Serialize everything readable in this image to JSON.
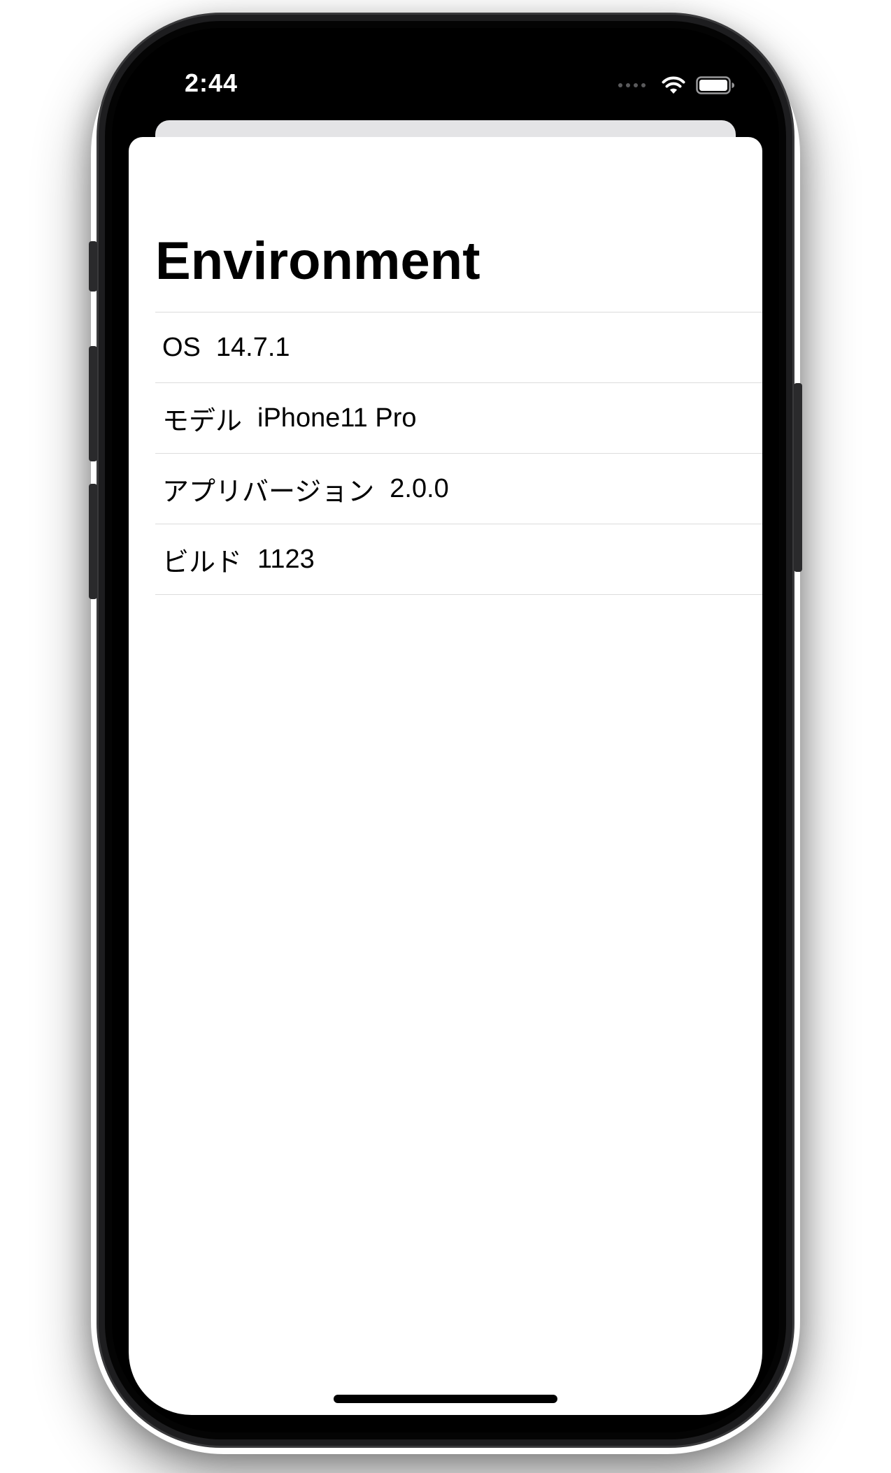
{
  "status_bar": {
    "time": "2:44"
  },
  "sheet": {
    "title": "Environment",
    "rows": [
      {
        "label": "OS",
        "value": "14.7.1"
      },
      {
        "label": "モデル",
        "value": "iPhone11 Pro"
      },
      {
        "label": "アプリバージョン",
        "value": "2.0.0"
      },
      {
        "label": "ビルド",
        "value": "1123"
      }
    ]
  },
  "colors": {
    "frame": "#1d1d1f",
    "screen_bezel": "#000000",
    "sheet_background": "#ffffff",
    "separator": "#dcdcdc",
    "back_card": "#e4e4e6"
  },
  "icons": [
    "cellular-dots-icon",
    "wifi-icon",
    "battery-icon"
  ]
}
